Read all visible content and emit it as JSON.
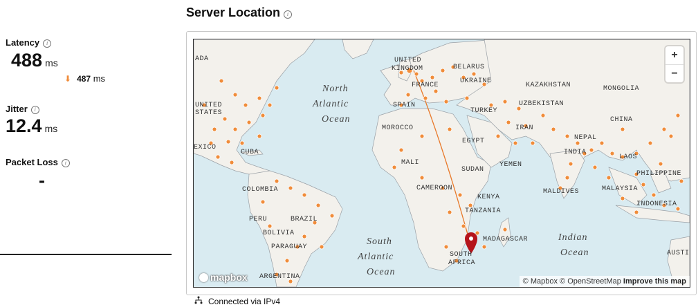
{
  "metrics": {
    "latency": {
      "label": "Latency",
      "value": "488",
      "unit": "ms",
      "download_value": "487",
      "download_unit": "ms"
    },
    "jitter": {
      "label": "Jitter",
      "value": "12.4",
      "unit": "ms"
    },
    "packet_loss": {
      "label": "Packet Loss",
      "value": "-"
    }
  },
  "server_location": {
    "title": "Server Location",
    "map_labels": {
      "canada": "ADA",
      "united_states": "UNITED\nSTATES",
      "mexico": "EXICO",
      "cuba": "CUBA",
      "colombia": "COLOMBIA",
      "peru": "PERU",
      "brazil": "BRAZIL",
      "bolivia": "BOLIVIA",
      "paraguay": "PARAGUAY",
      "argentina": "ARGENTINA",
      "north_atlantic": "North\nAtlantic\nOcean",
      "south_atlantic": "South\nAtlantic\nOcean",
      "indian_ocean": "Indian\nOcean",
      "united_kingdom": "UNITED\nKINGDOM",
      "belarus": "BELARUS",
      "ukraine": "UKRAINE",
      "france": "FRANCE",
      "spain": "SPAIN",
      "morocco": "MOROCCO",
      "turkey": "TURKEY",
      "egypt": "EGYPT",
      "mali": "MALI",
      "sudan": "SUDAN",
      "yemen": "YEMEN",
      "cameroon": "CAMEROON",
      "kenya": "KENYA",
      "tanzania": "TANZANIA",
      "madagascar": "MADAGASCAR",
      "south_africa": "SOUTH\nAFRICA",
      "kazakhstan": "KAZAKHSTAN",
      "mongolia": "MONGOLIA",
      "uzbekistan": "UZBEKISTAN",
      "iran": "IRAN",
      "nepal": "NEPAL",
      "india": "INDIA",
      "china": "CHINA",
      "maldives": "MALDIVES",
      "philippines": "PHILIPPINE",
      "laos": "LAOS",
      "malaysia": "MALAYSIA",
      "indonesia": "INDONESIA",
      "australia": "AUSTI"
    },
    "zoom_in": "+",
    "zoom_out": "−",
    "logo_text": "mapbox",
    "attribution": {
      "mapbox": "© Mapbox",
      "osm": "© OpenStreetMap",
      "improve": "Improve this map"
    },
    "colors": {
      "ocean": "#d9ebf1",
      "land": "#f3f1ec",
      "dot": "#f08c3a",
      "pin": "#b5141b",
      "route": "#e8792a"
    }
  },
  "connection": {
    "icon": "network-icon",
    "text": "Connected via IPv4"
  }
}
